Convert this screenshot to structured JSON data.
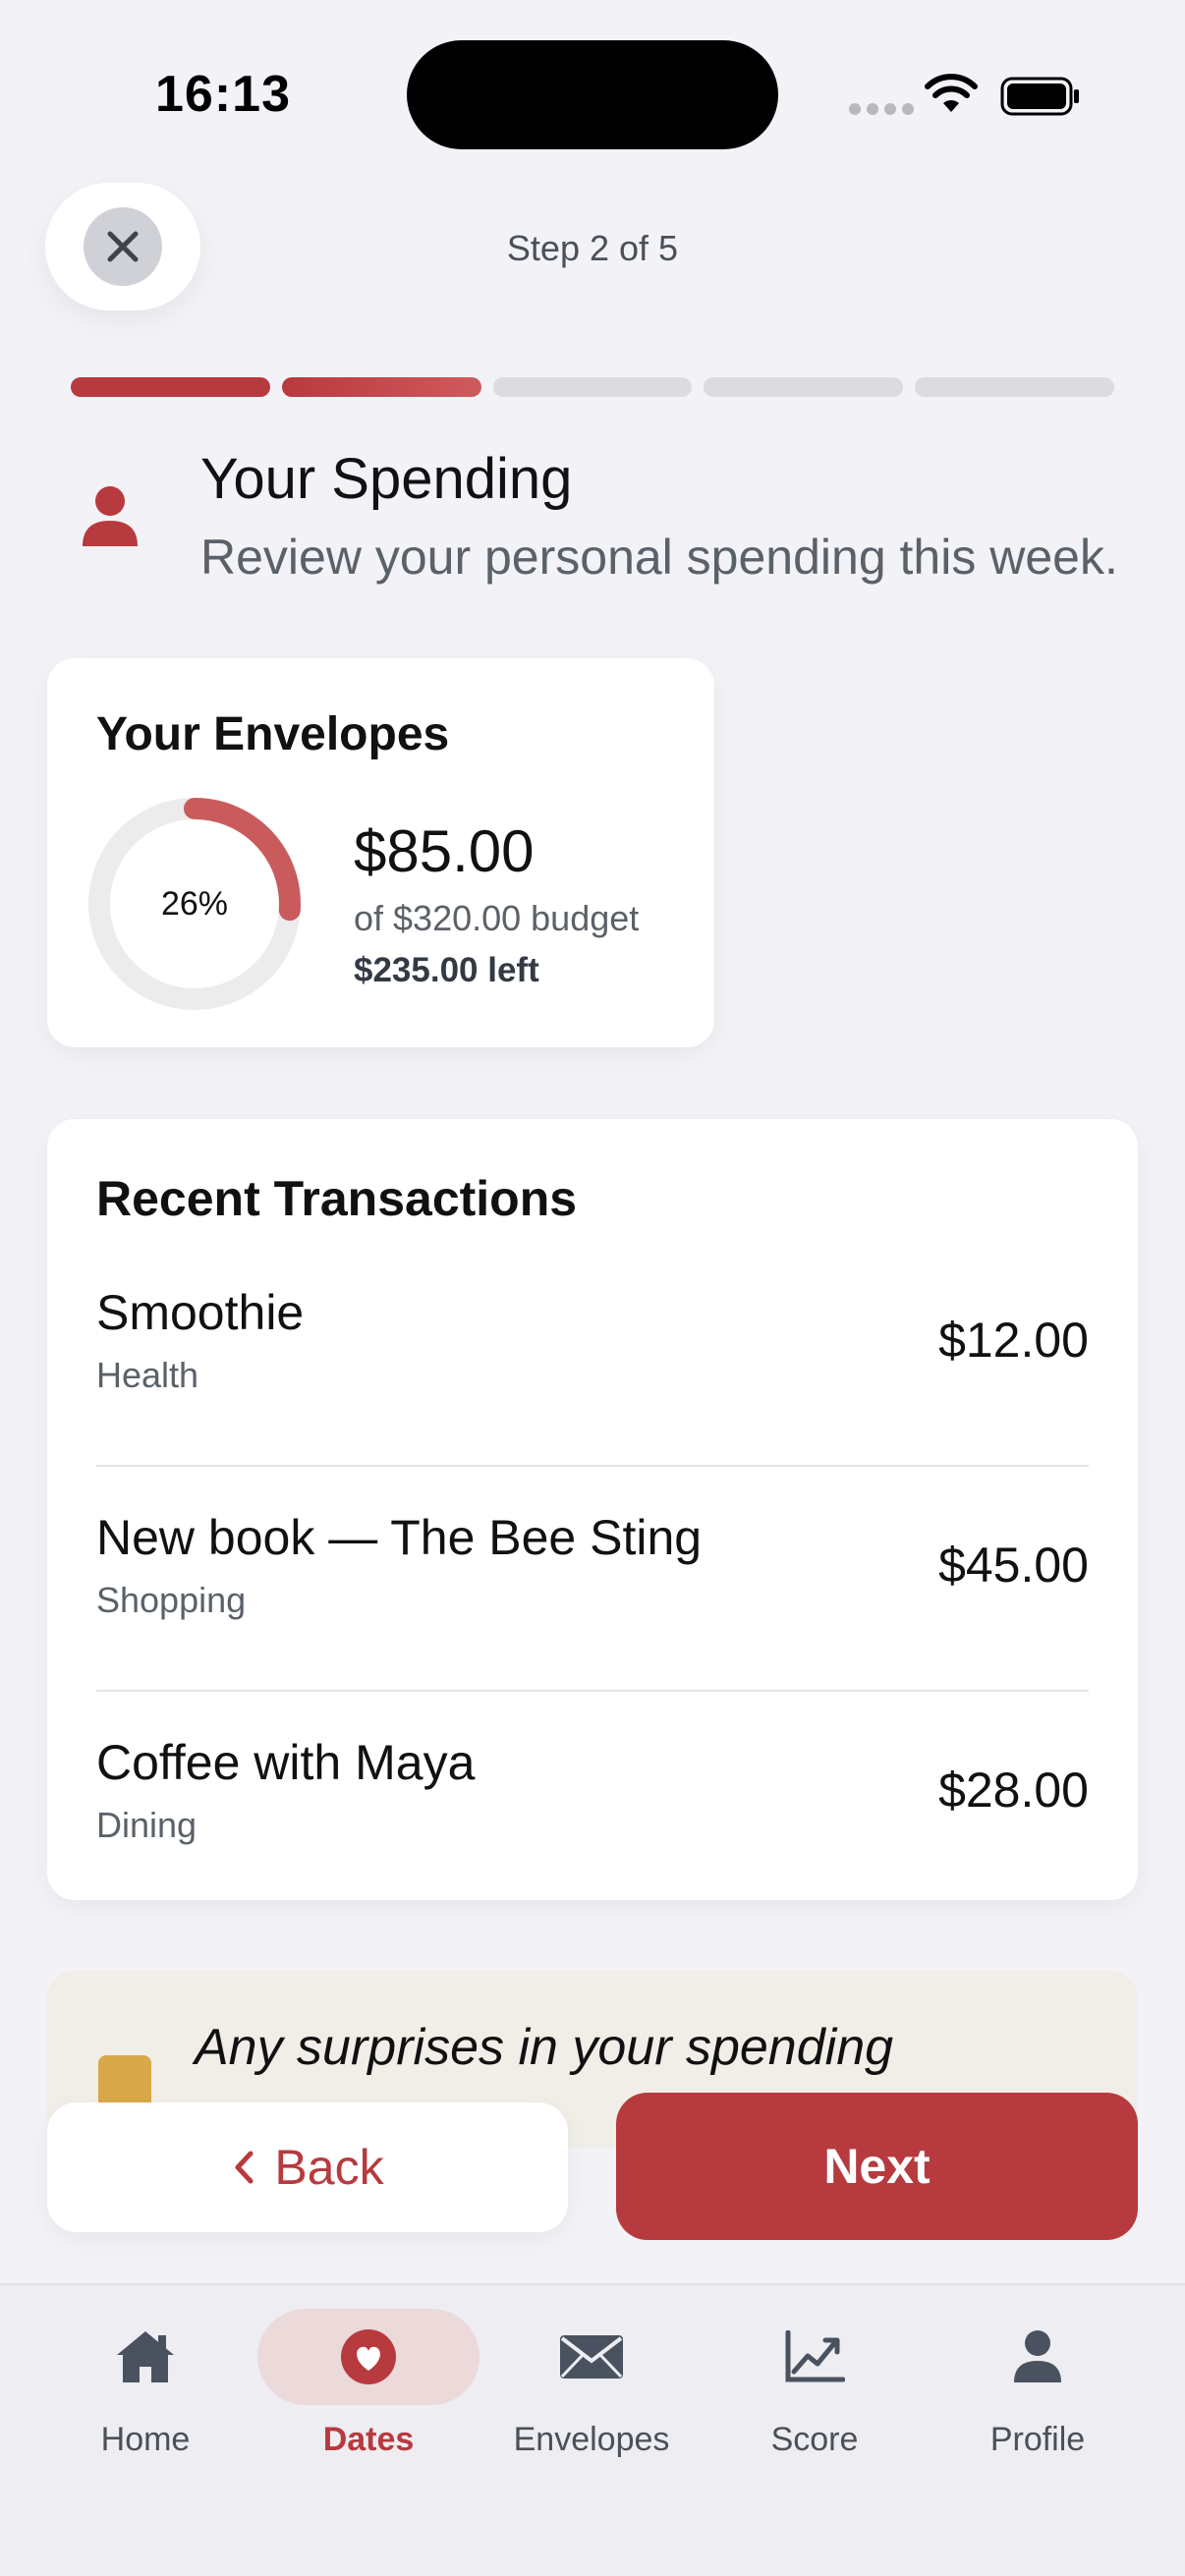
{
  "status_bar": {
    "time": "16:13"
  },
  "header": {
    "step_label": "Step 2 of 5",
    "steps_total": 5,
    "steps_completed": 2
  },
  "section": {
    "title": "Your Spending",
    "subtitle": "Review your personal spending this week.",
    "icon": "person-icon"
  },
  "envelopes": {
    "title": "Your Envelopes",
    "percent_label": "26%",
    "percent_value": 26,
    "spent": "$85.00",
    "budget_text": "of $320.00 budget",
    "left_text": "$235.00 left"
  },
  "transactions": {
    "title": "Recent Transactions",
    "items": [
      {
        "name": "Smoothie",
        "category": "Health",
        "amount": "$12.00"
      },
      {
        "name": "New book — The Bee Sting",
        "category": "Shopping",
        "amount": "$45.00"
      },
      {
        "name": "Coffee with Maya",
        "category": "Dining",
        "amount": "$28.00"
      }
    ]
  },
  "prompt": {
    "text": "Any surprises in your spending"
  },
  "buttons": {
    "back": "Back",
    "next": "Next"
  },
  "tabs": [
    {
      "label": "Home",
      "icon": "home-icon"
    },
    {
      "label": "Dates",
      "icon": "heart-icon",
      "active": true
    },
    {
      "label": "Envelopes",
      "icon": "envelope-icon"
    },
    {
      "label": "Score",
      "icon": "chart-icon"
    },
    {
      "label": "Profile",
      "icon": "person-icon"
    }
  ],
  "colors": {
    "accent": "#b73a3e",
    "background": "#f2f2f7",
    "prompt_bg": "#f1eee8",
    "prompt_icon": "#d8a849"
  }
}
